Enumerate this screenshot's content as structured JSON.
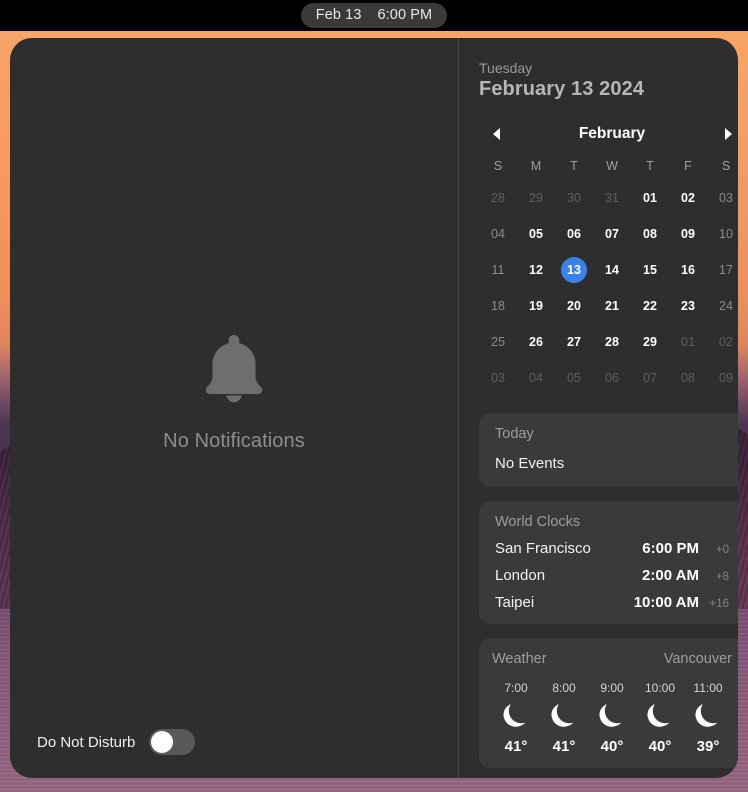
{
  "menubar": {
    "date": "Feb 13",
    "time": "6:00 PM"
  },
  "notifications": {
    "empty_label": "No Notifications",
    "bell_icon": "bell-icon",
    "do_not_disturb": {
      "label": "Do Not Disturb",
      "state": "off"
    }
  },
  "sidebar": {
    "weekday": "Tuesday",
    "full_date": "February 13 2024",
    "calendar": {
      "month": "February",
      "prev_icon": "chevron-left-icon",
      "next_icon": "chevron-right-icon",
      "weekday_initials": [
        "S",
        "M",
        "T",
        "W",
        "T",
        "F",
        "S"
      ],
      "selected_day": "13",
      "accent_color": "#3b82e8",
      "weeks": [
        [
          {
            "d": "28",
            "style": "dim"
          },
          {
            "d": "29",
            "style": "dim"
          },
          {
            "d": "30",
            "style": "dim"
          },
          {
            "d": "31",
            "style": "dim"
          },
          {
            "d": "01",
            "style": "normal"
          },
          {
            "d": "02",
            "style": "normal"
          },
          {
            "d": "03",
            "style": "weekend"
          }
        ],
        [
          {
            "d": "04",
            "style": "weekend"
          },
          {
            "d": "05",
            "style": "normal"
          },
          {
            "d": "06",
            "style": "normal"
          },
          {
            "d": "07",
            "style": "normal"
          },
          {
            "d": "08",
            "style": "normal"
          },
          {
            "d": "09",
            "style": "normal"
          },
          {
            "d": "10",
            "style": "weekend"
          }
        ],
        [
          {
            "d": "11",
            "style": "weekend"
          },
          {
            "d": "12",
            "style": "normal"
          },
          {
            "d": "13",
            "style": "selected"
          },
          {
            "d": "14",
            "style": "normal"
          },
          {
            "d": "15",
            "style": "normal"
          },
          {
            "d": "16",
            "style": "normal"
          },
          {
            "d": "17",
            "style": "weekend"
          }
        ],
        [
          {
            "d": "18",
            "style": "weekend"
          },
          {
            "d": "19",
            "style": "normal"
          },
          {
            "d": "20",
            "style": "normal"
          },
          {
            "d": "21",
            "style": "normal"
          },
          {
            "d": "22",
            "style": "normal"
          },
          {
            "d": "23",
            "style": "normal"
          },
          {
            "d": "24",
            "style": "weekend"
          }
        ],
        [
          {
            "d": "25",
            "style": "weekend"
          },
          {
            "d": "26",
            "style": "normal"
          },
          {
            "d": "27",
            "style": "normal"
          },
          {
            "d": "28",
            "style": "normal"
          },
          {
            "d": "29",
            "style": "normal"
          },
          {
            "d": "01",
            "style": "dim"
          },
          {
            "d": "02",
            "style": "dim"
          }
        ],
        [
          {
            "d": "03",
            "style": "dim"
          },
          {
            "d": "04",
            "style": "dim"
          },
          {
            "d": "05",
            "style": "dim"
          },
          {
            "d": "06",
            "style": "dim"
          },
          {
            "d": "07",
            "style": "dim"
          },
          {
            "d": "08",
            "style": "dim"
          },
          {
            "d": "09",
            "style": "dim"
          }
        ]
      ]
    },
    "today_card": {
      "title": "Today",
      "events_text": "No Events"
    },
    "world_clocks": {
      "title": "World Clocks",
      "rows": [
        {
          "city": "San Francisco",
          "time": "6:00 PM",
          "offset": "+0"
        },
        {
          "city": "London",
          "time": "2:00 AM",
          "offset": "+8"
        },
        {
          "city": "Taipei",
          "time": "10:00 AM",
          "offset": "+16"
        }
      ]
    },
    "weather": {
      "title": "Weather",
      "city": "Vancouver",
      "hours": [
        {
          "time": "7:00",
          "icon": "crescent-moon-icon",
          "temp": "41°"
        },
        {
          "time": "8:00",
          "icon": "crescent-moon-icon",
          "temp": "41°"
        },
        {
          "time": "9:00",
          "icon": "crescent-moon-icon",
          "temp": "40°"
        },
        {
          "time": "10:00",
          "icon": "crescent-moon-icon",
          "temp": "40°"
        },
        {
          "time": "11:00",
          "icon": "crescent-moon-icon",
          "temp": "39°"
        }
      ]
    }
  }
}
